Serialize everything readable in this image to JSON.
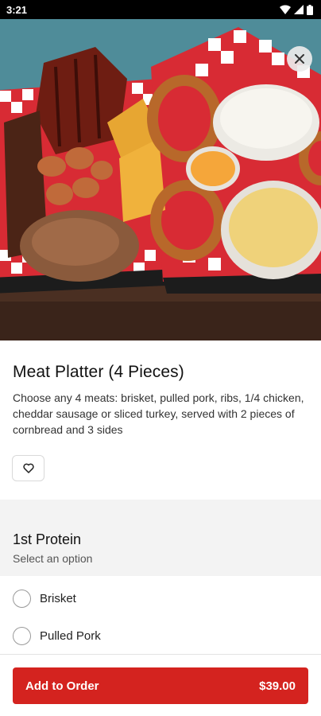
{
  "status_bar": {
    "time": "3:21"
  },
  "item": {
    "title": "Meat Platter (4 Pieces)",
    "description": "Choose any 4 meats: brisket, pulled pork, ribs, 1/4 chicken, cheddar sausage or sliced turkey, served with 2 pieces of cornbread and 3 sides"
  },
  "option_group": {
    "title": "1st Protein",
    "subtitle": "Select an option",
    "options": [
      {
        "label": "Brisket"
      },
      {
        "label": "Pulled Pork"
      },
      {
        "label": ""
      }
    ]
  },
  "footer": {
    "add_label": "Add to Order",
    "price": "$39.00"
  },
  "colors": {
    "accent": "#d4231f"
  }
}
